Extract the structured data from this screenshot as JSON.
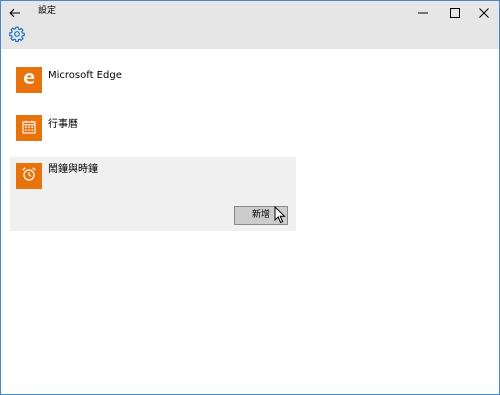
{
  "window": {
    "title": "設定",
    "icons": {
      "back": "arrow-left-icon",
      "minimize": "minimize-icon",
      "maximize": "maximize-icon",
      "close": "close-icon",
      "settings": "gear-icon"
    }
  },
  "apps": [
    {
      "name": "Microsoft Edge",
      "icon": "edge-icon"
    },
    {
      "name": "行事曆",
      "icon": "calendar-icon"
    },
    {
      "name": "鬧鐘與時鐘",
      "icon": "alarm-clock-icon",
      "selected": true,
      "action_label": "新增"
    }
  ],
  "colors": {
    "tile": "#e8730c",
    "accent": "#1a73c8",
    "selected_background": "#f0f0f0",
    "titlebar": "#e6e6e6"
  }
}
